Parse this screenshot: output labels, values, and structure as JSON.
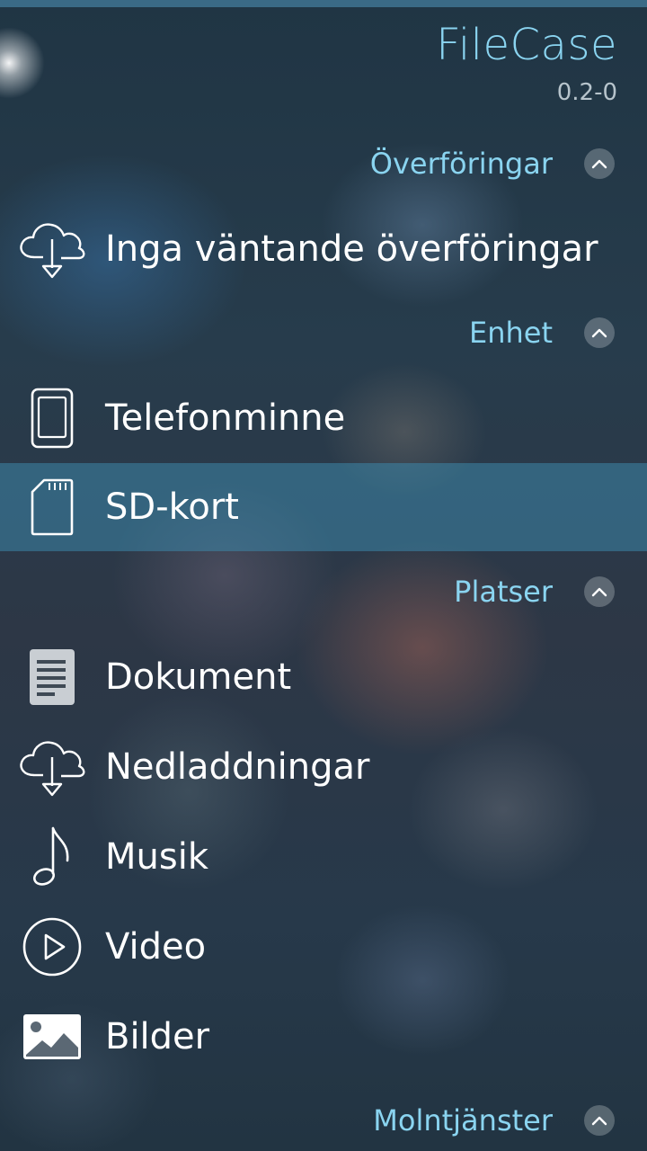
{
  "app": {
    "title": "FileCase",
    "version": "0.2-0"
  },
  "colors": {
    "accent": "#8ad4f0",
    "selected_row": "#3c87aa"
  },
  "sections": {
    "transfers": {
      "header": "Överföringar",
      "items": [
        {
          "label": "Inga väntande överföringar",
          "icon": "cloud-download-icon"
        }
      ]
    },
    "device": {
      "header": "Enhet",
      "items": [
        {
          "label": "Telefonminne",
          "icon": "phone-icon"
        },
        {
          "label": "SD-kort",
          "icon": "sd-card-icon",
          "selected": true
        }
      ]
    },
    "places": {
      "header": "Platser",
      "items": [
        {
          "label": "Dokument",
          "icon": "document-icon"
        },
        {
          "label": "Nedladdningar",
          "icon": "cloud-download-icon"
        },
        {
          "label": "Musik",
          "icon": "music-note-icon"
        },
        {
          "label": "Video",
          "icon": "play-circle-icon"
        },
        {
          "label": "Bilder",
          "icon": "image-icon"
        }
      ]
    },
    "cloud": {
      "header": "Molntjänster"
    }
  }
}
